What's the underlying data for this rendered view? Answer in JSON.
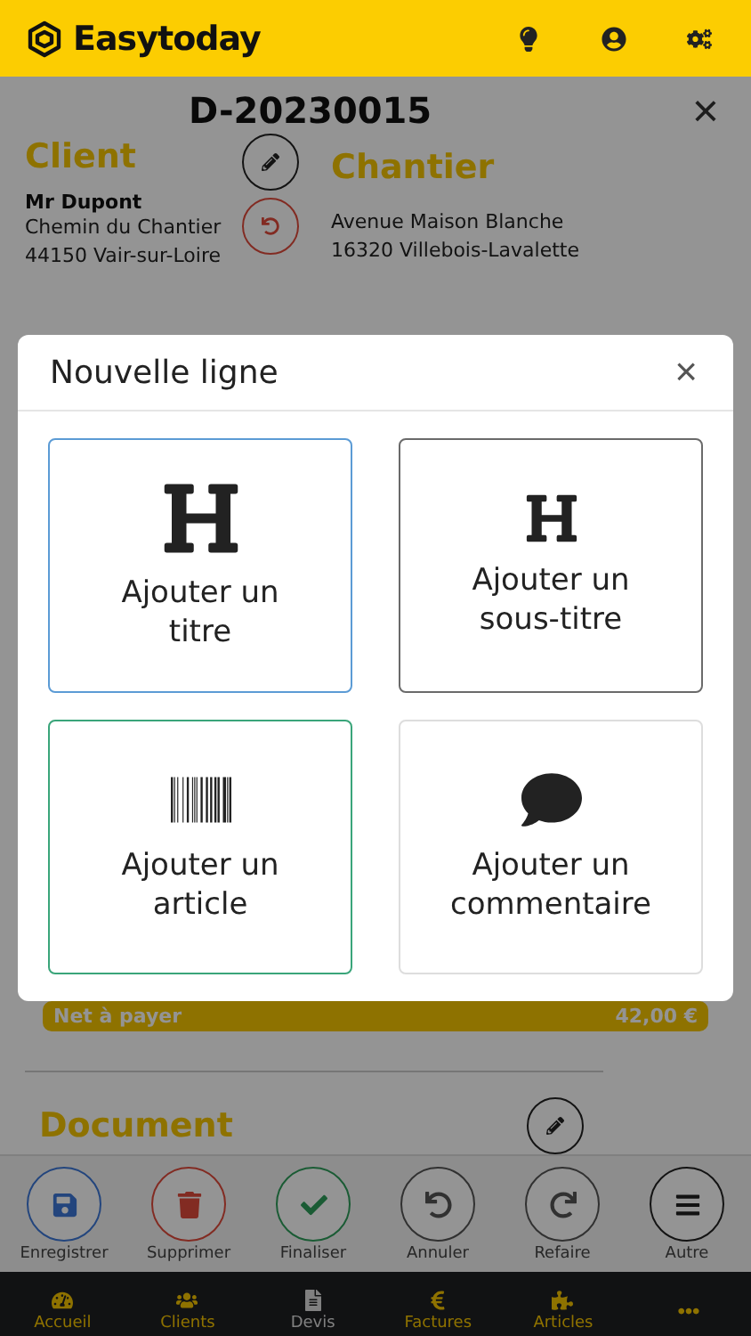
{
  "app": {
    "name": "Easytoday"
  },
  "header_icons": [
    {
      "kind": "bulb"
    },
    {
      "kind": "user"
    },
    {
      "kind": "settings"
    }
  ],
  "document": {
    "number": "D-20230015",
    "close": "×"
  },
  "client": {
    "heading": "Client",
    "name": "Mr Dupont",
    "lines": [
      "Chemin du Chantier",
      "44150 Vair-sur-Loire"
    ]
  },
  "chantier": {
    "heading": "Chantier",
    "lines": [
      "Avenue Maison Blanche",
      "16320 Villebois-Lavalette"
    ]
  },
  "net": {
    "label": "Net à payer",
    "amount": "42,00 €"
  },
  "section": {
    "heading": "Document"
  },
  "dialog": {
    "title": "Nouvelle ligne",
    "close": "×",
    "options": [
      {
        "kind": "title",
        "label": "Ajouter un titre",
        "color": "#5b9bd5"
      },
      {
        "kind": "subtitle",
        "label": "Ajouter un sous-titre",
        "color": "#6a6a6a"
      },
      {
        "kind": "barcode",
        "label": "Ajouter un article",
        "color": "#3aa57a"
      },
      {
        "kind": "comment",
        "label": "Ajouter un commentaire",
        "color": "#dddddd"
      }
    ]
  },
  "actions": [
    {
      "kind": "save",
      "label": "Enregistrer"
    },
    {
      "kind": "delete",
      "label": "Supprimer"
    },
    {
      "kind": "finalize",
      "label": "Finaliser"
    },
    {
      "kind": "undo",
      "label": "Annuler"
    },
    {
      "kind": "redo",
      "label": "Refaire"
    },
    {
      "kind": "more",
      "label": "Autre"
    }
  ],
  "nav": [
    {
      "kind": "home",
      "label": "Accueil",
      "selected": false
    },
    {
      "kind": "clients",
      "label": "Clients",
      "selected": false
    },
    {
      "kind": "quotes",
      "label": "Devis",
      "selected": true
    },
    {
      "kind": "invoices",
      "label": "Factures",
      "selected": false
    },
    {
      "kind": "articles",
      "label": "Articles",
      "selected": false
    },
    {
      "kind": "more",
      "selected": false
    }
  ]
}
